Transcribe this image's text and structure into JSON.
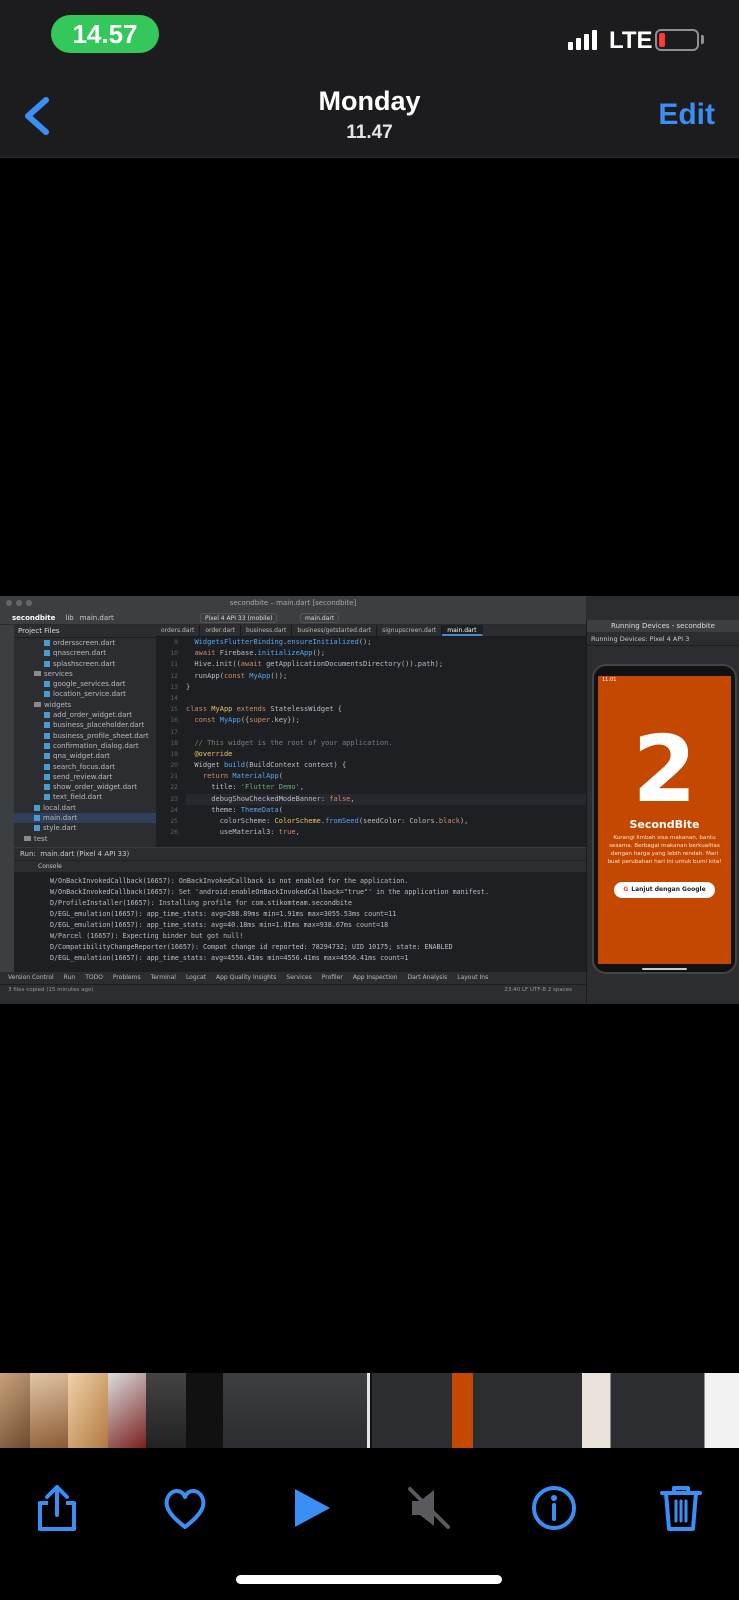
{
  "status_bar": {
    "time": "14.57",
    "network": "LTE"
  },
  "nav": {
    "title": "Monday",
    "subtitle": "11.47",
    "edit_label": "Edit"
  },
  "screenshot": {
    "ide_title": "secondbite – main.dart [secondbite]",
    "breadcrumb": [
      "secondbite",
      "lib",
      "main.dart"
    ],
    "device_selector": "Pixel 4 API 33 (mobile)",
    "run_config": "main.dart",
    "project_panel_title": "Project Files",
    "tree": [
      {
        "label": "ordersscreen.dart",
        "type": "file",
        "indent": 3
      },
      {
        "label": "qnascreen.dart",
        "type": "file",
        "indent": 3
      },
      {
        "label": "splashscreen.dart",
        "type": "file",
        "indent": 3
      },
      {
        "label": "services",
        "type": "folder",
        "indent": 2
      },
      {
        "label": "google_services.dart",
        "type": "file",
        "indent": 3
      },
      {
        "label": "location_service.dart",
        "type": "file",
        "indent": 3
      },
      {
        "label": "widgets",
        "type": "folder",
        "indent": 2
      },
      {
        "label": "add_order_widget.dart",
        "type": "file",
        "indent": 3
      },
      {
        "label": "business_placeholder.dart",
        "type": "file",
        "indent": 3
      },
      {
        "label": "business_profile_sheet.dart",
        "type": "file",
        "indent": 3
      },
      {
        "label": "confirmation_dialog.dart",
        "type": "file",
        "indent": 3
      },
      {
        "label": "qna_widget.dart",
        "type": "file",
        "indent": 3
      },
      {
        "label": "search_focus.dart",
        "type": "file",
        "indent": 3
      },
      {
        "label": "send_review.dart",
        "type": "file",
        "indent": 3
      },
      {
        "label": "show_order_widget.dart",
        "type": "file",
        "indent": 3
      },
      {
        "label": "text_field.dart",
        "type": "file",
        "indent": 3
      },
      {
        "label": "local.dart",
        "type": "file",
        "indent": 2
      },
      {
        "label": "main.dart",
        "type": "file",
        "indent": 2,
        "selected": true
      },
      {
        "label": "style.dart",
        "type": "file",
        "indent": 2
      },
      {
        "label": "test",
        "type": "folder",
        "indent": 1
      }
    ],
    "editor_tabs": [
      "orders.dart",
      "order.dart",
      "business.dart",
      "business/getstarted.dart",
      "signupscreen.dart",
      "main.dart"
    ],
    "line_numbers": [
      "9",
      "10",
      "11",
      "12",
      "13",
      "14",
      "15",
      "16",
      "17",
      "18",
      "19",
      "20",
      "21",
      "22",
      "23",
      "24",
      "25",
      "26"
    ],
    "run_tab": "main.dart (Pixel 4 API 33)",
    "console_label": "Console",
    "log_lines": [
      "W/OnBackInvokedCallback(16657): OnBackInvokedCallback is not enabled for the application.",
      "W/OnBackInvokedCallback(16657): Set 'android:enableOnBackInvokedCallback=\"true\"' in the application manifest.",
      "D/ProfileInstaller(16657): Installing profile for com.stikomteam.secondbite",
      "D/EGL_emulation(16657): app_time_stats: avg=288.89ms min=1.91ms max=3055.53ms count=11",
      "D/EGL_emulation(16657): app_time_stats: avg=40.18ms min=1.81ms max=938.67ms count=18",
      "W/Parcel  (16657): Expecting binder but got null!",
      "D/CompatibilityChangeReporter(16657): Compat change id reported: 78294732; UID 10175; state: ENABLED",
      "D/EGL_emulation(16657): app_time_stats: avg=4556.41ms min=4556.41ms max=4556.41ms count=1"
    ],
    "bottom_tools": [
      "Version Control",
      "Run",
      "TODO",
      "Problems",
      "Terminal",
      "Logcat",
      "App Quality Insights",
      "Services",
      "Profiler",
      "App Inspection",
      "Dart Analysis",
      "Layout Ins"
    ],
    "status_left": "3 files copied (15 minutes ago)",
    "status_right": "23:40   LF   UTF-8   2 spaces",
    "devices_title": "Running Devices - secondbite",
    "devices_tab": "Running Devices:   Pixel 4 API 3",
    "phone_time": "11:01",
    "app_logo_digit": "2",
    "app_name": "SecondBite",
    "app_tagline": "Kurangi limbah sisa makanan, bantu sesama. Berbagai makanan berkualitas dengan harga yang lebih rendah. Mari buat perubahan hari ini untuk bumi kita!",
    "google_button": "Lanjut dengan Google"
  },
  "toolbar": {
    "icons": [
      "share-icon",
      "heart-icon",
      "play-icon",
      "mute-icon",
      "info-icon",
      "trash-icon"
    ]
  },
  "colors": {
    "accent": "#3a8ff5",
    "time_pill": "#34c759",
    "app_orange": "#c44800"
  }
}
